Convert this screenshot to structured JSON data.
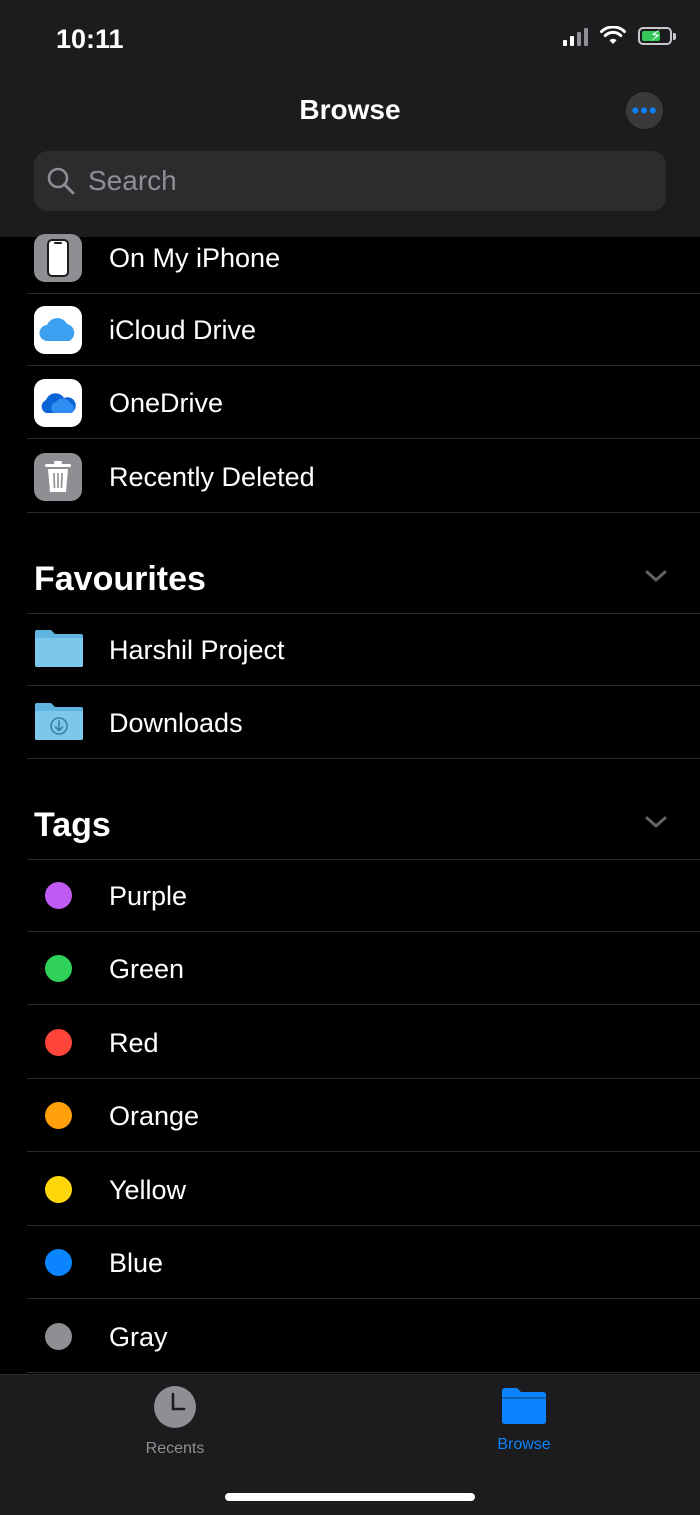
{
  "status_bar": {
    "time": "10:11"
  },
  "header": {
    "title": "Browse",
    "more_label": "•••"
  },
  "search": {
    "placeholder": "Search"
  },
  "locations": [
    {
      "label": "On My iPhone",
      "icon": "iphone-icon"
    },
    {
      "label": "iCloud Drive",
      "icon": "icloud-icon"
    },
    {
      "label": "OneDrive",
      "icon": "onedrive-icon"
    },
    {
      "label": "Recently Deleted",
      "icon": "trash-icon"
    }
  ],
  "favourites": {
    "title": "Favourites",
    "items": [
      {
        "label": "Harshil Project",
        "icon": "folder-icon"
      },
      {
        "label": "Downloads",
        "icon": "downloads-folder-icon"
      }
    ]
  },
  "tags": {
    "title": "Tags",
    "items": [
      {
        "label": "Purple",
        "color": "#bf5af2"
      },
      {
        "label": "Green",
        "color": "#30d158"
      },
      {
        "label": "Red",
        "color": "#ff453a"
      },
      {
        "label": "Orange",
        "color": "#ff9f0a"
      },
      {
        "label": "Yellow",
        "color": "#ffd60a"
      },
      {
        "label": "Blue",
        "color": "#0a84ff"
      },
      {
        "label": "Gray",
        "color": "#8e8e93"
      }
    ]
  },
  "tabbar": {
    "recents": {
      "label": "Recents",
      "color": "#8e8e93"
    },
    "browse": {
      "label": "Browse",
      "color": "#0a84ff"
    }
  }
}
